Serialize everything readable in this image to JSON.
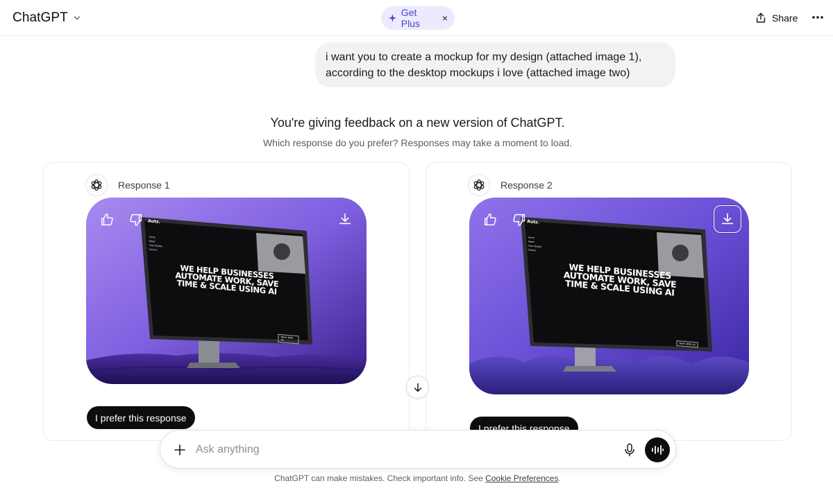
{
  "header": {
    "brand_title": "ChatGPT",
    "get_plus_label": "Get Plus",
    "get_plus_close": "×",
    "share_label": "Share"
  },
  "conversation": {
    "user_message": "i want you to create a mockup for my design (attached image 1), according to the desktop mockups i love (attached image two)"
  },
  "feedback": {
    "title": "You're giving feedback on a new version of ChatGPT.",
    "subtitle": "Which response do you prefer? Responses may take a moment to load.",
    "responses": [
      {
        "label": "Response 1",
        "prefer_label": "I prefer this response",
        "screen": {
          "logo": "Autz.",
          "nav": [
            "Home",
            "About",
            "Case Studies",
            "Contact"
          ],
          "headline": [
            "WE HELP BUSINESSES",
            "AUTOMATE WORK, SAVE",
            "TIME & SCALE USING AI"
          ],
          "cta": "Work With Us"
        }
      },
      {
        "label": "Response 2",
        "prefer_label": "I prefer this response",
        "screen": {
          "logo": "Autz.",
          "nav": [
            "Home",
            "About",
            "Case Studies",
            "Contact"
          ],
          "headline": [
            "WE HELP BUSINESSES",
            "AUTOMATE WORK, SAVE",
            "TIME & SCALE USING AI"
          ],
          "cta": "Work With Us"
        }
      }
    ]
  },
  "composer": {
    "placeholder": "Ask anything"
  },
  "footer": {
    "text": "ChatGPT can make mistakes. Check important info. See ",
    "link": "Cookie Preferences",
    "end": "."
  },
  "colors": {
    "accent": "#4b45c6",
    "get_plus_bg": "#eceafd",
    "mockup_purple": "#6b4fd8",
    "dark": "#0d0d0d"
  },
  "icons": [
    "chevron-down-icon",
    "sparkle-icon",
    "share-icon",
    "more-icon",
    "openai-logo-icon",
    "thumbs-up-icon",
    "thumbs-down-icon",
    "download-icon",
    "arrow-down-icon",
    "plus-icon",
    "mic-icon",
    "voice-mode-icon"
  ]
}
